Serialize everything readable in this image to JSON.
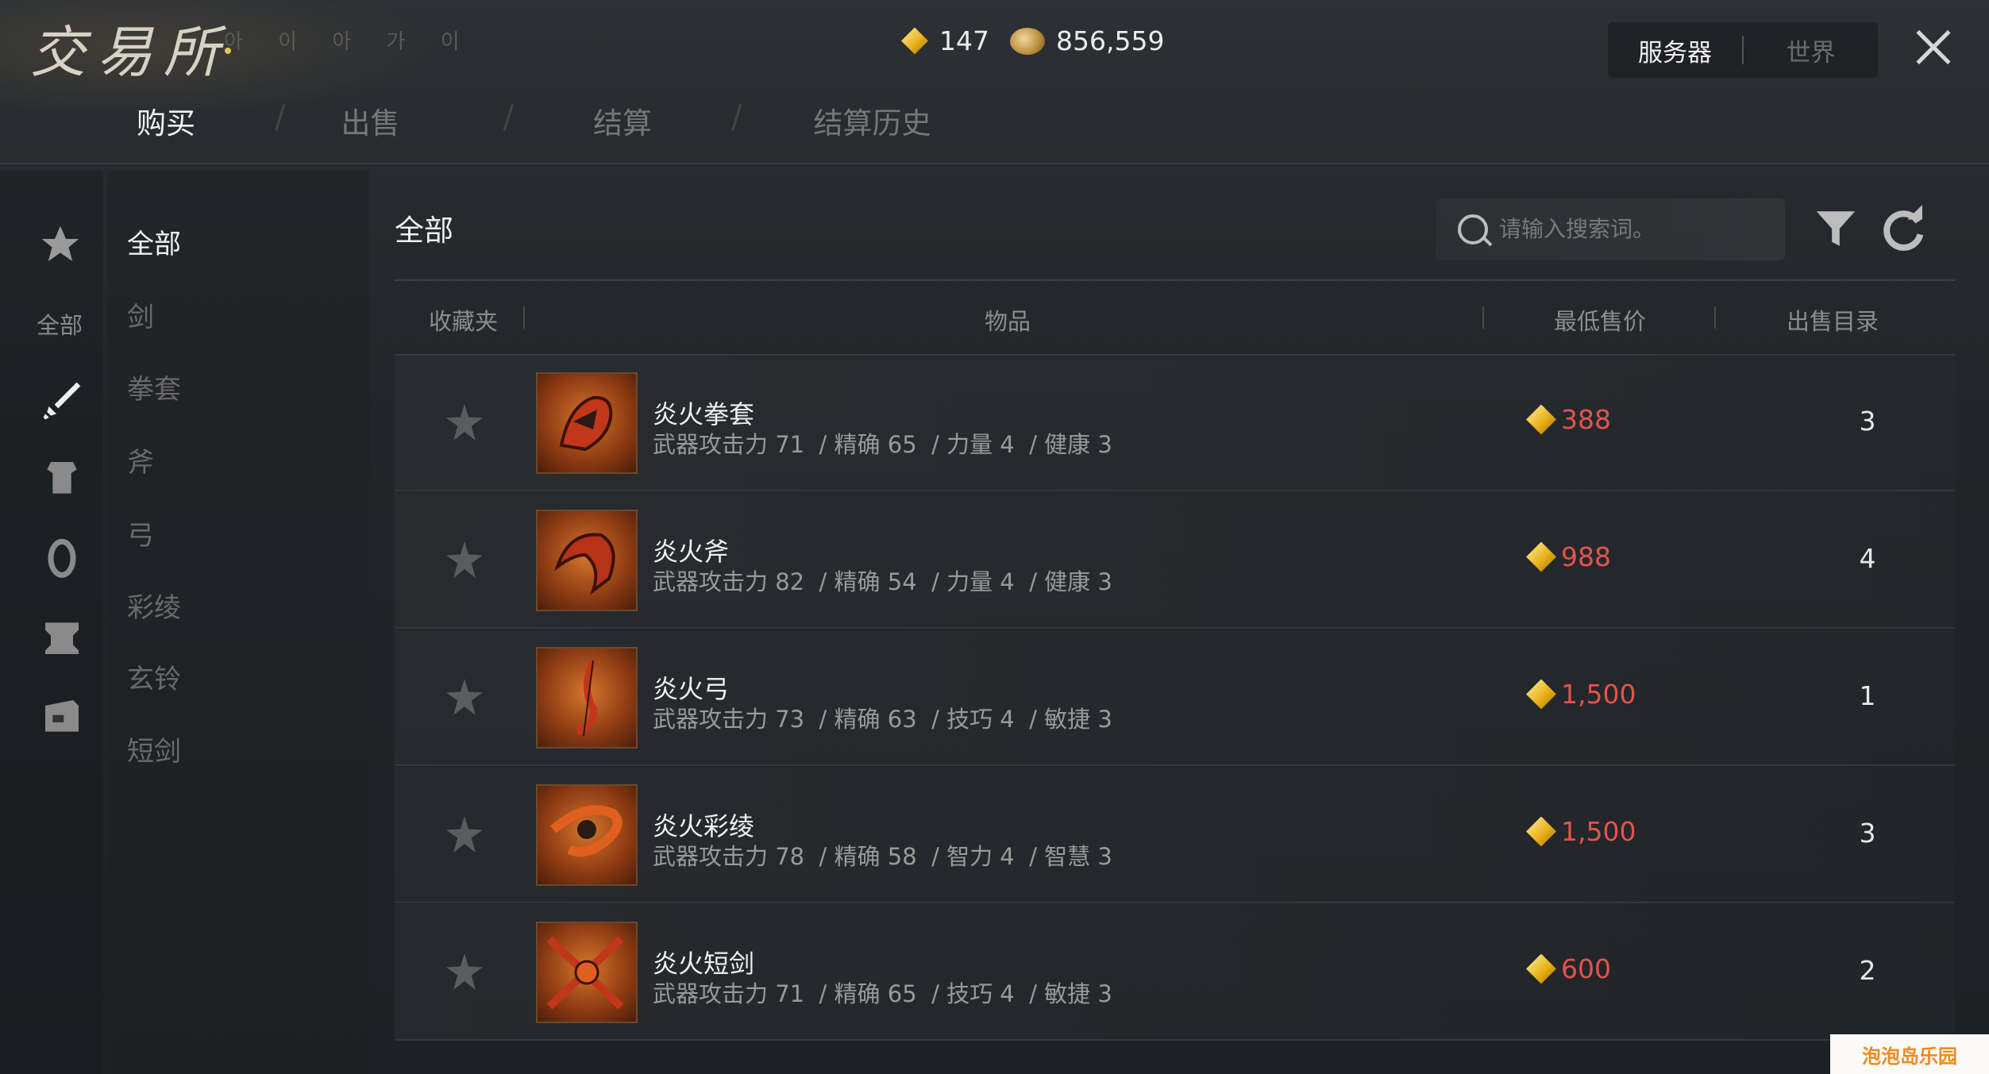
{
  "app": {
    "title": "交易所",
    "title_sub": "아 이 아 가 이"
  },
  "currency": {
    "gems": "147",
    "coins": "856,559"
  },
  "server_toggle": {
    "server": "服务器",
    "world": "世界"
  },
  "tabs": [
    {
      "label": "购买",
      "active": true
    },
    {
      "label": "出售",
      "active": false
    },
    {
      "label": "结算",
      "active": false
    },
    {
      "label": "结算历史",
      "active": false
    }
  ],
  "rail": {
    "all_label": "全部"
  },
  "categories": [
    {
      "label": "全部",
      "active": true
    },
    {
      "label": "剑",
      "active": false
    },
    {
      "label": "拳套",
      "active": false
    },
    {
      "label": "斧",
      "active": false
    },
    {
      "label": "弓",
      "active": false
    },
    {
      "label": "彩绫",
      "active": false
    },
    {
      "label": "玄铃",
      "active": false
    },
    {
      "label": "短剑",
      "active": false
    }
  ],
  "main": {
    "title": "全部"
  },
  "search": {
    "placeholder": "请输入搜索词。"
  },
  "table": {
    "headers": {
      "favorite": "收藏夹",
      "item": "物品",
      "lowest_price": "最低售价",
      "listings": "出售目录"
    },
    "rows": [
      {
        "name": "炎火拳套",
        "stats": "武器攻击力 71  / 精确 65  / 力量 4  / 健康 3",
        "price": "388",
        "count": "3"
      },
      {
        "name": "炎火斧",
        "stats": "武器攻击力 82  / 精确 54  / 力量 4  / 健康 3",
        "price": "988",
        "count": "4"
      },
      {
        "name": "炎火弓",
        "stats": "武器攻击力 73  / 精确 63  / 技巧 4  / 敏捷 3",
        "price": "1,500",
        "count": "1"
      },
      {
        "name": "炎火彩绫",
        "stats": "武器攻击力 78  / 精确 58  / 智力 4  / 智慧 3",
        "price": "1,500",
        "count": "3"
      },
      {
        "name": "炎火短剑",
        "stats": "武器攻击力 71  / 精确 65  / 技巧 4  / 敏捷 3",
        "price": "600",
        "count": "2"
      }
    ]
  },
  "watermark": "泡泡岛乐园",
  "colors": {
    "price": "#e2544a",
    "gem": "#e9b21a",
    "accent_text": "#f0f0f0"
  }
}
